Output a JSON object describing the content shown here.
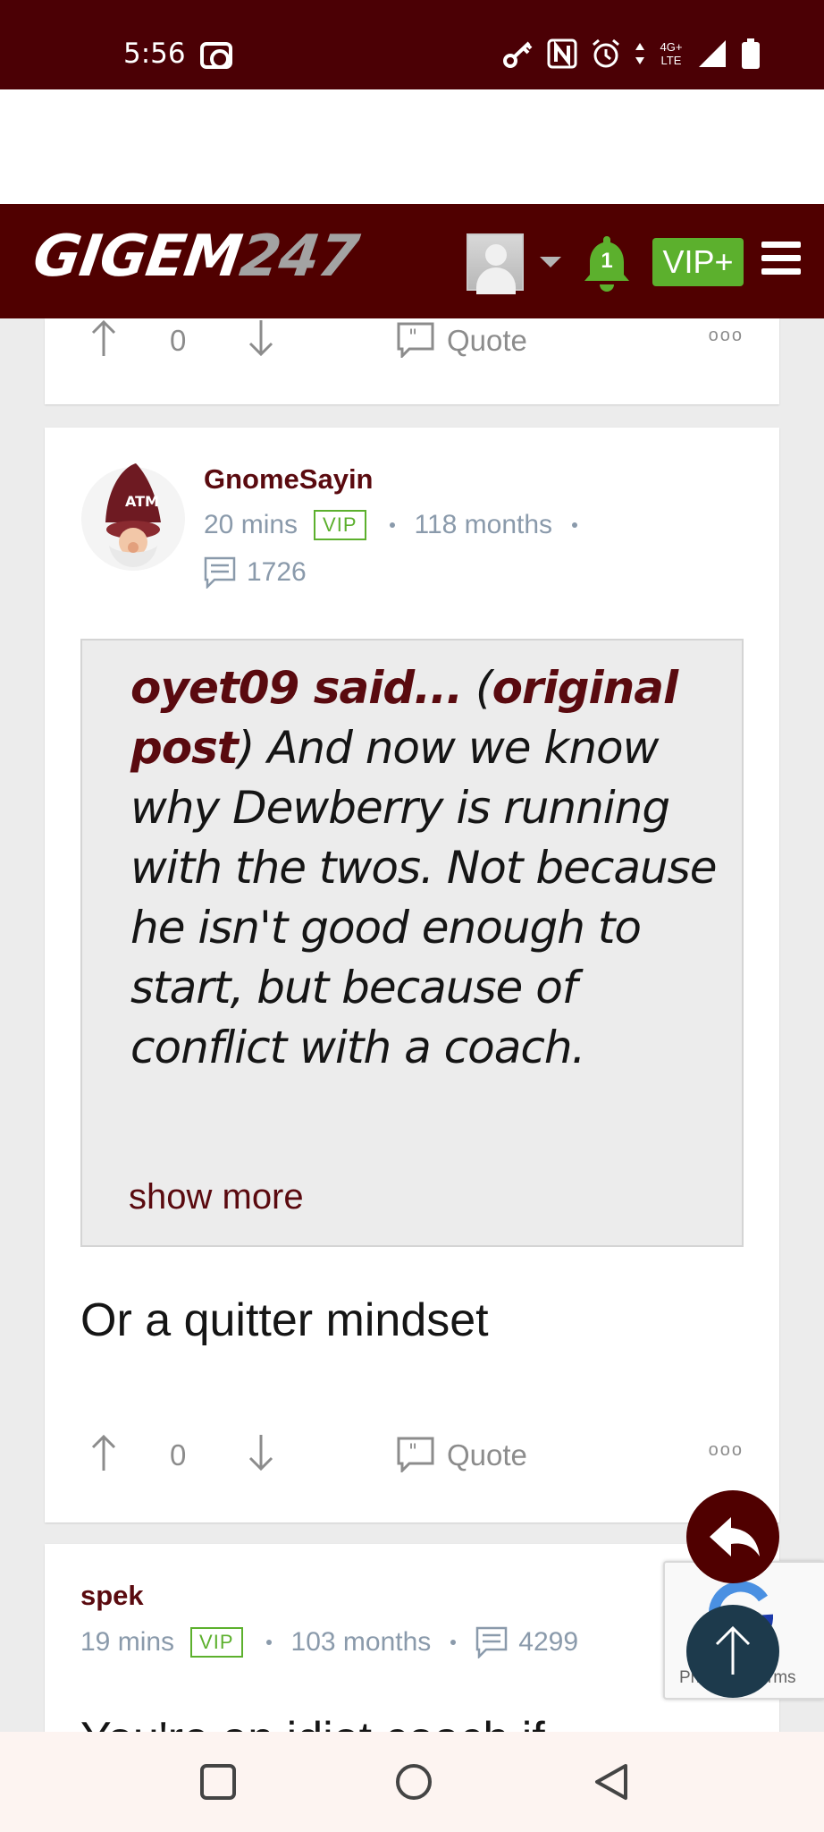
{
  "status_bar": {
    "time": "5:56",
    "network": "4G+ LTE",
    "icons": [
      "screen-record-icon",
      "key-icon",
      "nfc-icon",
      "alarm-icon",
      "signal-icon",
      "battery-icon"
    ]
  },
  "header": {
    "logo_main": "GIGEM",
    "logo_num": "247",
    "notification_count": "1",
    "vip_label": "VIP+"
  },
  "previous_post": {
    "vote_count": "0",
    "quote_label": "Quote",
    "more_label": "ooo"
  },
  "post": {
    "username": "GnomeSayin",
    "time": "20 mins",
    "badge": "VIP",
    "tenure": "118 months",
    "post_count": "1726",
    "quote": {
      "author_said": "oyet09 said...",
      "paren_open": " (",
      "original_post_link": "original post",
      "paren_close": ")",
      "text": " And now we know why Dewberry is running with the twos. Not because he isn't good enough to start, but because of conflict with a coach.",
      "show_more": "show more"
    },
    "body": "Or a quitter mindset",
    "vote_count": "0",
    "quote_label": "Quote",
    "more_label": "ooo"
  },
  "next_post": {
    "username": "spek",
    "time": "19 mins",
    "badge": "VIP",
    "tenure": "103 months",
    "post_count": "4299",
    "body_partial": "You're an idiot coach if"
  },
  "recaptcha": {
    "text": "Privacy - Terms"
  },
  "colors": {
    "brand_maroon": "#500000",
    "vip_green": "#5cb02d",
    "meta_gray": "#8a9aab",
    "fab_dark_blue": "#1d3a4c"
  }
}
